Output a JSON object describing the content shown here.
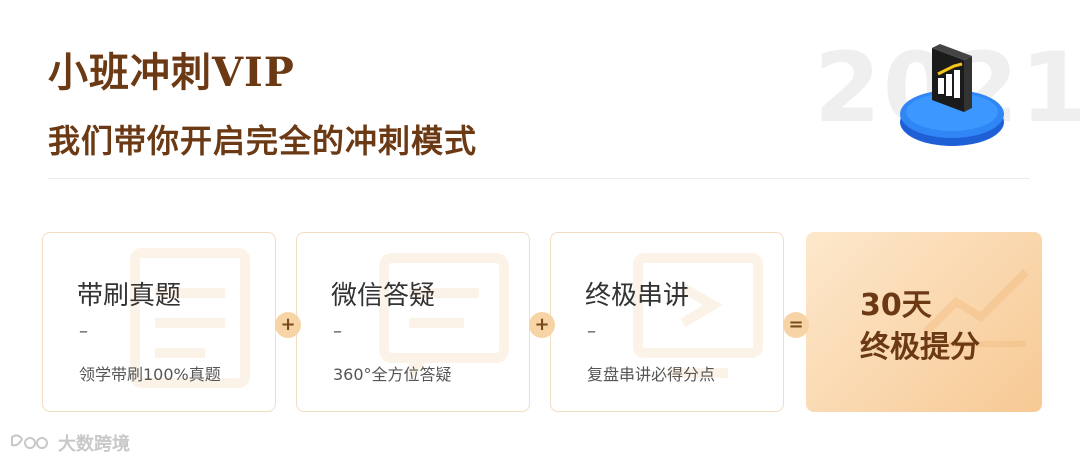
{
  "header": {
    "title": "小班冲刺VIP",
    "subtitle": "我们带你开启完全的冲刺模式",
    "year_watermark": "2021",
    "chart_icon": "bar-chart-3d-icon"
  },
  "cards": [
    {
      "title": "带刷真题",
      "dash": "–",
      "desc": "领学带刷100%真题",
      "bg_icon": "document-list-icon"
    },
    {
      "title": "微信答疑",
      "dash": "–",
      "desc": "360°全方位答疑",
      "bg_icon": "chat-bubble-icon"
    },
    {
      "title": "终极串讲",
      "dash": "–",
      "desc": "复盘串讲必得分点",
      "bg_icon": "play-screen-icon"
    }
  ],
  "operators": [
    "+",
    "+",
    "="
  ],
  "result": {
    "line1": "30天",
    "line2": "终极提分",
    "bg_icon": "trend-up-icon"
  },
  "watermark": {
    "text": "大数跨境",
    "icon": "brand-logo-icon"
  },
  "colors": {
    "brand_brown": "#6b3a14",
    "card_border": "#f3dcc2",
    "operator_bg": "#f7d4a6",
    "result_gradient_start": "#fde8cc",
    "result_gradient_end": "#f7c994"
  }
}
